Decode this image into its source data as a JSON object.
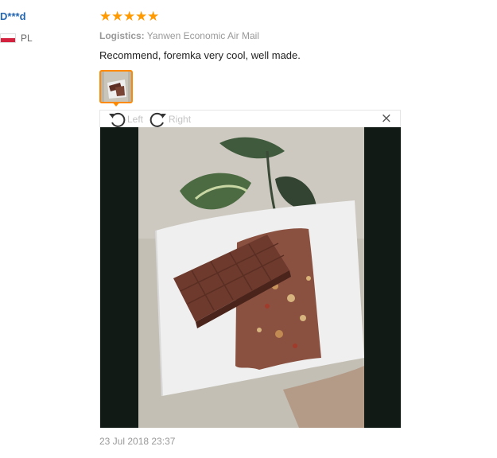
{
  "reviewer": {
    "name": "D***d",
    "country_code": "PL"
  },
  "review": {
    "rating": 5,
    "stars": [
      "★",
      "★",
      "★",
      "★",
      "★"
    ],
    "logistics_label": "Logistics:",
    "logistics_value": "Yanwen Economic Air Mail",
    "text": "Recommend, foremka very cool, well made.",
    "date": "23 Jul 2018 23:37"
  },
  "viewer": {
    "rotate_left_label": "Left",
    "rotate_right_label": "Right",
    "close_glyph": "×",
    "rotate_left_icon": "rotate-left-icon",
    "rotate_right_icon": "rotate-right-icon"
  },
  "colors": {
    "reviewer_name": "#2667b0",
    "star": "#ff9a00",
    "thumb_border": "#ff8a00"
  }
}
